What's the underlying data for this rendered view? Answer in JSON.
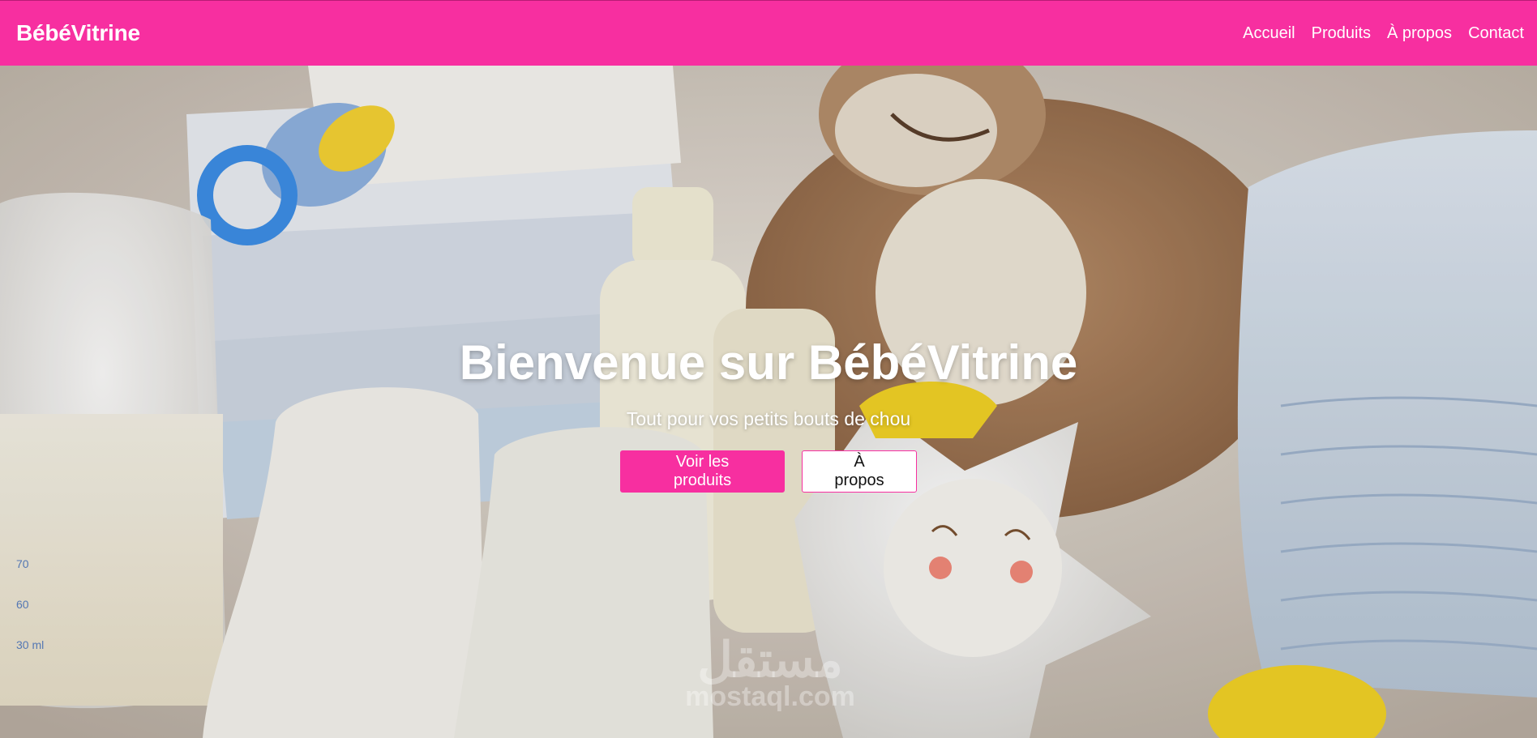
{
  "navbar": {
    "brand": "BébéVitrine",
    "links": [
      "Accueil",
      "Produits",
      "À propos",
      "Contact"
    ]
  },
  "hero": {
    "title": "Bienvenue sur BébéVitrine",
    "subtitle": "Tout pour vos petits bouts de chou",
    "primary_button": "Voir les produits",
    "secondary_button": "À propos",
    "background_description_icon": "baby-products-photo"
  },
  "watermark": {
    "arabic": "مستقل",
    "url": "mostaql.com"
  },
  "colors": {
    "accent": "#f72fa0",
    "text_light": "#ffffff"
  }
}
